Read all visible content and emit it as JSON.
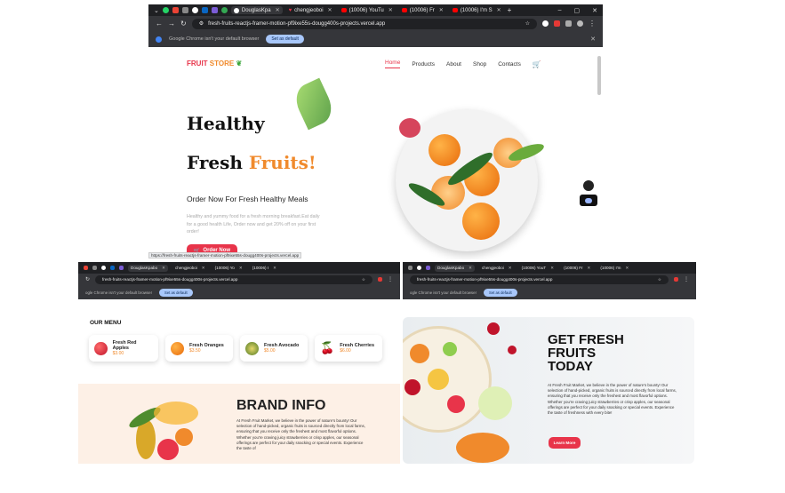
{
  "main_browser": {
    "tabs": [
      "DouglasKpa",
      "chengjeoboi",
      "(10006) YouTu",
      "(10006) Fr",
      "(10006) I'm S"
    ],
    "url": "fresh-fruits-reactjs-framer-motion-pf9ixe55s-dougg400s-projects.vercel.app",
    "infobar_text": "Google Chrome isn't your default browser",
    "infobar_button": "Set as default",
    "status_url": "https://fresh-fruits-reactjs-framer-motion-pf9ixe55s-dougg400s-projects.vercel.app"
  },
  "site": {
    "brand_a": "FRUIT",
    "brand_b": "STORE",
    "nav": [
      "Home",
      "Products",
      "About",
      "Shop",
      "Contacts"
    ],
    "hero_line1": "Healthy",
    "hero_line2a": "Fresh",
    "hero_line2b": "Fruits!",
    "hero_sub": "Order Now For Fresh Healthy Meals",
    "hero_body": "Healthy and yummy food for a fresh morning breakfast.Eat daily for a good health Life, Order now and get 20% off on your first order!",
    "hero_cta": "Order Now"
  },
  "left_window": {
    "tabs": [
      "DouglasKpabo",
      "chengjeoboi",
      "(10006) Yo",
      "(10006) I"
    ],
    "url": "fresh-fruits-reactjs-framer-motion-pf9ixe55s-dougg400s-projects.vercel.app",
    "infobar_text": "ogle Chrome isn't your default browser",
    "infobar_button": "Set as default",
    "menu_title": "OUR MENU",
    "menu": [
      {
        "name": "Fresh Red Apples",
        "price": "$3.00"
      },
      {
        "name": "Fresh Oranges",
        "price": "$3.50"
      },
      {
        "name": "Fresh Avocado",
        "price": "$5.00"
      },
      {
        "name": "Fresh Cherries",
        "price": "$6.00"
      }
    ],
    "brand_title": "BRAND INFO",
    "brand_body": "At Fresh Fruit Market, we believe in the power of nature's bounty! Our selection of hand-picked, organic fruits is sourced directly from local farms, ensuring that you receive only the freshest and most flavorful options. Whether you're craving juicy strawberries or crisp apples, our seasonal offerings are perfect for your daily snacking or special events. Experience the taste of"
  },
  "right_window": {
    "tabs": [
      "DouglasKpabo",
      "chengjeoboi",
      "(10006) YouT",
      "(10006) Fr",
      "(10006) I'm"
    ],
    "url": "fresh-fruits-reactjs-framer-motion-pf9ixe55s-dougg400s-projects.vercel.app",
    "infobar_text": "ogle Chrome isn't your default browser",
    "infobar_button": "Set as default",
    "title_l1": "GET FRESH",
    "title_l2": "FRUITS",
    "title_l3": "TODAY",
    "body": "At Fresh Fruit Market, we believe in the power of nature's bounty! Our selection of hand-picked, organic fruits is sourced directly from local farms, ensuring that you receive only the freshest and most flavorful options. Whether you're craving juicy strawberries or crisp apples, our seasonal offerings are perfect for your daily snacking or special events. Experience the taste of freshness with every bite!",
    "cta": "Learn More"
  },
  "colors": {
    "accent_red": "#e8344a",
    "accent_orange": "#f08a2c",
    "brand_green": "#3aa53a"
  }
}
